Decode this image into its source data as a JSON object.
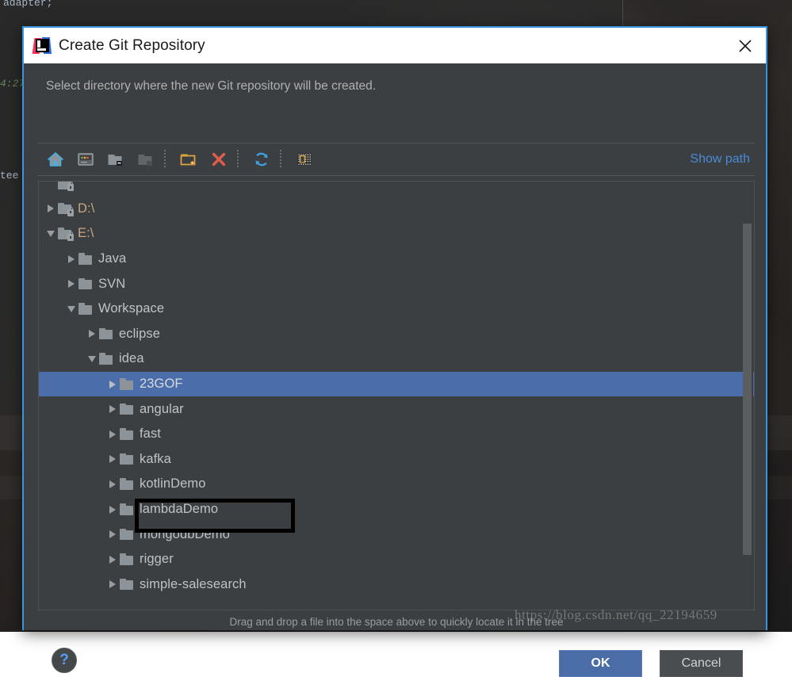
{
  "background": {
    "code_line_1": "adapter;",
    "code_line_2": "4:27",
    "code_line_3": "tee"
  },
  "dialog": {
    "title": "Create Git Repository",
    "close_icon": "close-icon",
    "logo_icon": "intellij-idea-logo-icon",
    "subtitle": "Select directory where the new Git repository will be created.",
    "show_path_label": "Show path",
    "hint": "Drag and drop a file into the space above to quickly locate it in the tree",
    "help_label": "?",
    "ok_label": "OK",
    "cancel_label": "Cancel"
  },
  "toolbar": {
    "buttons": [
      {
        "name": "home-icon",
        "tooltip": "Home",
        "disabled": false
      },
      {
        "name": "desktop-icon",
        "tooltip": "Desktop",
        "disabled": false
      },
      {
        "name": "project-folder-icon",
        "tooltip": "Project Directory",
        "disabled": false
      },
      {
        "name": "module-folder-icon",
        "tooltip": "Module Directory",
        "disabled": true
      },
      {
        "name": "new-folder-icon",
        "tooltip": "New Folder",
        "disabled": false
      },
      {
        "name": "delete-icon",
        "tooltip": "Delete",
        "disabled": false
      },
      {
        "name": "refresh-icon",
        "tooltip": "Refresh",
        "disabled": false
      },
      {
        "name": "hide-path-icon",
        "tooltip": "Show Hidden Files",
        "disabled": false
      }
    ]
  },
  "tree": {
    "rows": [
      {
        "label": "",
        "indent": 0,
        "state": "partial",
        "icon": "folder-locked-icon",
        "kind": "drive",
        "selected": false,
        "clipped": true
      },
      {
        "label": "D:\\",
        "indent": 0,
        "state": "collapsed",
        "icon": "folder-locked-icon",
        "kind": "drive",
        "selected": false
      },
      {
        "label": "E:\\",
        "indent": 0,
        "state": "expanded",
        "icon": "folder-locked-icon",
        "kind": "drive",
        "selected": false
      },
      {
        "label": "Java",
        "indent": 1,
        "state": "collapsed",
        "icon": "folder-icon",
        "kind": "folder",
        "selected": false
      },
      {
        "label": "SVN",
        "indent": 1,
        "state": "collapsed",
        "icon": "folder-icon",
        "kind": "folder",
        "selected": false
      },
      {
        "label": "Workspace",
        "indent": 1,
        "state": "expanded",
        "icon": "folder-icon",
        "kind": "folder",
        "selected": false
      },
      {
        "label": "eclipse",
        "indent": 2,
        "state": "collapsed",
        "icon": "folder-icon",
        "kind": "folder",
        "selected": false
      },
      {
        "label": "idea",
        "indent": 2,
        "state": "expanded",
        "icon": "folder-icon",
        "kind": "folder",
        "selected": false
      },
      {
        "label": "23GOF",
        "indent": 3,
        "state": "collapsed",
        "icon": "folder-icon",
        "kind": "folder",
        "selected": true
      },
      {
        "label": "angular",
        "indent": 3,
        "state": "collapsed",
        "icon": "folder-icon",
        "kind": "folder",
        "selected": false
      },
      {
        "label": "fast",
        "indent": 3,
        "state": "collapsed",
        "icon": "folder-icon",
        "kind": "folder",
        "selected": false
      },
      {
        "label": "kafka",
        "indent": 3,
        "state": "collapsed",
        "icon": "folder-icon",
        "kind": "folder",
        "selected": false
      },
      {
        "label": "kotlinDemo",
        "indent": 3,
        "state": "collapsed",
        "icon": "folder-icon",
        "kind": "folder",
        "selected": false
      },
      {
        "label": "lambdaDemo",
        "indent": 3,
        "state": "collapsed",
        "icon": "folder-icon",
        "kind": "folder",
        "selected": false
      },
      {
        "label": "mongodbDemo",
        "indent": 3,
        "state": "collapsed",
        "icon": "folder-icon",
        "kind": "folder",
        "selected": false
      },
      {
        "label": "rigger",
        "indent": 3,
        "state": "collapsed",
        "icon": "folder-icon",
        "kind": "folder",
        "selected": false
      },
      {
        "label": "simple-salesearch",
        "indent": 3,
        "state": "collapsed",
        "icon": "folder-icon",
        "kind": "folder",
        "selected": false
      }
    ],
    "selected_label": "23GOF"
  },
  "watermark": {
    "text": "https://blog.csdn.net/qq_22194659"
  },
  "colors": {
    "dialog_border": "#3a95e0",
    "titlebar_bg": "#ffffff",
    "panel_bg": "#3c3f41",
    "selection_blue": "#4b6eab",
    "link_blue": "#4a8bd6",
    "ok_button": "#4a6da7",
    "text_primary": "#bfc3c6",
    "drive_text": "#c9a783",
    "highlight_box": "#000000"
  }
}
